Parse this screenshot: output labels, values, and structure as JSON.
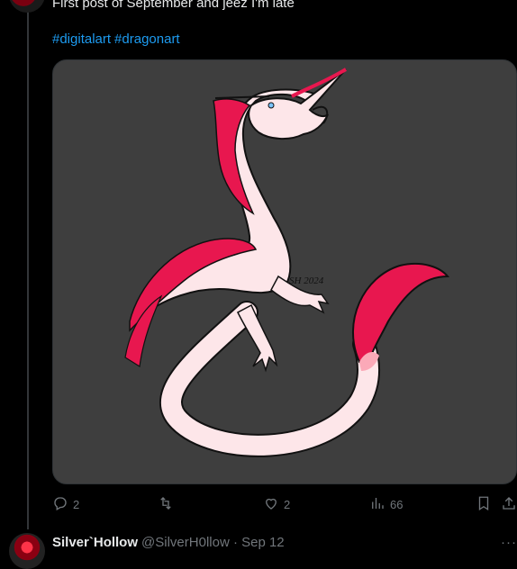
{
  "post": {
    "text": "First post of September and jeez I'm late",
    "hashtags": [
      "#digitalart",
      "#dragonart"
    ],
    "image_signature": "SH 2024"
  },
  "actions": {
    "replies": "2",
    "likes": "2",
    "views": "66"
  },
  "next_reply": {
    "display_name": "Silver`Hollow",
    "handle_date": "@SilverH0llow · Sep 12",
    "more": "···"
  },
  "icons": {
    "reply": "speech-bubble-icon",
    "repost": "repost-arrows-icon",
    "like": "heart-icon",
    "views": "bar-chart-icon",
    "bookmark": "bookmark-icon",
    "share": "share-upload-icon"
  },
  "colors": {
    "background": "#000000",
    "link": "#1d9bf0",
    "muted": "#71767b",
    "media_bg": "#3e3e3e",
    "dragon_pink": "#e8174f",
    "dragon_body": "#fde6e9"
  }
}
